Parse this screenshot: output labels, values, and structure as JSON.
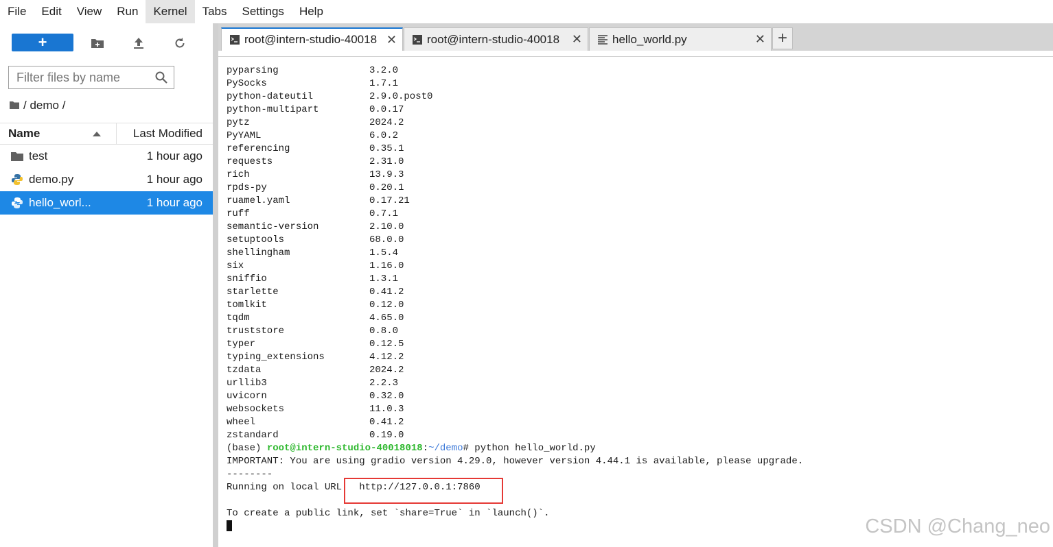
{
  "menu": [
    "File",
    "Edit",
    "View",
    "Run",
    "Kernel",
    "Tabs",
    "Settings",
    "Help"
  ],
  "menu_active": "Kernel",
  "filebrowser": {
    "new_label": "+",
    "filter_placeholder": "Filter files by name",
    "breadcrumb": "/ demo /",
    "col_name": "Name",
    "col_modified": "Last Modified",
    "files": [
      {
        "name": "test",
        "modified": "1 hour ago",
        "type": "folder",
        "selected": false
      },
      {
        "name": "demo.py",
        "modified": "1 hour ago",
        "type": "python",
        "selected": false
      },
      {
        "name": "hello_worl...",
        "modified": "1 hour ago",
        "type": "python",
        "selected": true
      }
    ]
  },
  "tabs": [
    {
      "label": "root@intern-studio-40018",
      "type": "terminal",
      "active": true
    },
    {
      "label": "root@intern-studio-40018",
      "type": "terminal",
      "active": false
    },
    {
      "label": "hello_world.py",
      "type": "editor",
      "active": false
    }
  ],
  "tab_close_glyph": "✕",
  "add_tab_glyph": "+",
  "terminal": {
    "packages": [
      [
        "pyparsing",
        "3.2.0"
      ],
      [
        "PySocks",
        "1.7.1"
      ],
      [
        "python-dateutil",
        "2.9.0.post0"
      ],
      [
        "python-multipart",
        "0.0.17"
      ],
      [
        "pytz",
        "2024.2"
      ],
      [
        "PyYAML",
        "6.0.2"
      ],
      [
        "referencing",
        "0.35.1"
      ],
      [
        "requests",
        "2.31.0"
      ],
      [
        "rich",
        "13.9.3"
      ],
      [
        "rpds-py",
        "0.20.1"
      ],
      [
        "ruamel.yaml",
        "0.17.21"
      ],
      [
        "ruff",
        "0.7.1"
      ],
      [
        "semantic-version",
        "2.10.0"
      ],
      [
        "setuptools",
        "68.0.0"
      ],
      [
        "shellingham",
        "1.5.4"
      ],
      [
        "six",
        "1.16.0"
      ],
      [
        "sniffio",
        "1.3.1"
      ],
      [
        "starlette",
        "0.41.2"
      ],
      [
        "tomlkit",
        "0.12.0"
      ],
      [
        "tqdm",
        "4.65.0"
      ],
      [
        "truststore",
        "0.8.0"
      ],
      [
        "typer",
        "0.12.5"
      ],
      [
        "typing_extensions",
        "4.12.2"
      ],
      [
        "tzdata",
        "2024.2"
      ],
      [
        "urllib3",
        "2.2.3"
      ],
      [
        "uvicorn",
        "0.32.0"
      ],
      [
        "websockets",
        "11.0.3"
      ],
      [
        "wheel",
        "0.41.2"
      ],
      [
        "zstandard",
        "0.19.0"
      ]
    ],
    "prompt_env": "(base) ",
    "prompt_user": "root@intern-studio-40018018",
    "prompt_sep": ":",
    "prompt_path": "~/demo",
    "prompt_cmd": "# python hello_world.py",
    "important_line": "IMPORTANT: You are using gradio version 4.29.0, however version 4.44.1 is available, please upgrade.",
    "dash_line": "--------",
    "running_label": "Running on local URL:  ",
    "running_url": "http://127.0.0.1:7860",
    "share_line": "To create a public link, set `share=True` in `launch()`."
  },
  "watermark": "CSDN @Chang_neo",
  "colors": {
    "accent": "#1976d2",
    "selected_row": "#1e88e5",
    "prompt_green": "#2eb82e",
    "path_blue": "#3b78d8",
    "highlight_red": "#e53935"
  }
}
